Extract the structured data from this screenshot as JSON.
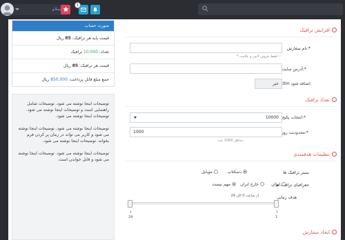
{
  "topbar": {
    "search_placeholder": "",
    "user_button_label": "سلام",
    "notification_count": "1",
    "icons": [
      "search-icon",
      "star-icon",
      "mail-icon",
      "bell-icon",
      "avatar-icon",
      "chevron-down-icon"
    ],
    "colors": {
      "bar": "#2b2d33",
      "star": "#e2405c",
      "mail": "#28a2d6",
      "bell": "#28a2d6",
      "link": "#5fb3ea"
    }
  },
  "sections": {
    "increase_traffic": "افزایش ترافیک",
    "traffic_count": "تعداد ترافیک",
    "targeting": "تنظیمات هدفمندی",
    "create_order": "ایجاد سفارش"
  },
  "form": {
    "order_name_label": "نام سفارش:*",
    "order_name_hint": "* فقط حروف لاتین و علامت '-'",
    "site_address_label": "آدرس سایت:*",
    "utm_label": "Utm اضافه شود:",
    "utm_value": "خیر",
    "package_label": "انتخاب پکیج:*",
    "package_value": "10000",
    "daily_limit_label": "محدودیت روزانه:*",
    "daily_limit_value": "1000",
    "daily_limit_hint": "حداقل 1000 عدد."
  },
  "targeting": {
    "platform_label": "بستر ترافیک ها",
    "platform_options": [
      "دسکتاپ",
      "موبایل"
    ],
    "platform_selected": "دسکتاپ",
    "geo_label": "جغرافیای ترافیک ها",
    "geo_options": [
      "مهم نیست",
      "خارج ایران",
      "ایران"
    ],
    "geo_selected": "مهم نیست",
    "time_label": "هدف زمانی",
    "time_range_text": "از ساعت 0 الی 24",
    "slider_min_label": "24",
    "slider_max_label": "1"
  },
  "account": {
    "title": "صورت حساب",
    "rows": [
      {
        "prefix": "قیمت پایه هر ترافیک: ",
        "value": "85",
        "suffix": " ریال"
      },
      {
        "prefix": "تعداد: ",
        "value": "10,000",
        "suffix": " ترافیک"
      },
      {
        "prefix": "قیمت هر ترافیک: ",
        "value": "85",
        "suffix": " ریال"
      },
      {
        "prefix": "جمع مبلغ قابل پرداخت: ",
        "value": "850,000",
        "suffix": " ریال"
      }
    ],
    "colors": {
      "header": "#2f7ec9",
      "count": "#2eaa5b",
      "total": "#2f7ec9"
    }
  },
  "description": {
    "paragraphs": [
      "توضیحات اینجا نوشته می شود. توضیحات شامل راهنمایی است و توضیحات اینجا نوشته می شود. توضیحات اینجا نوشته می شود.",
      "توضیحات اینجا نوشته می شود. توضیحات اینجا نوشته می شود و کاربر می تواند در زمان پر کردن فرم بخواند. توضیحات اینجا نوشته می شود.",
      "توضیحات اینجا نوشته می شود. توضیحات اینجا نوشته می شود و قابل خواندن است."
    ]
  }
}
